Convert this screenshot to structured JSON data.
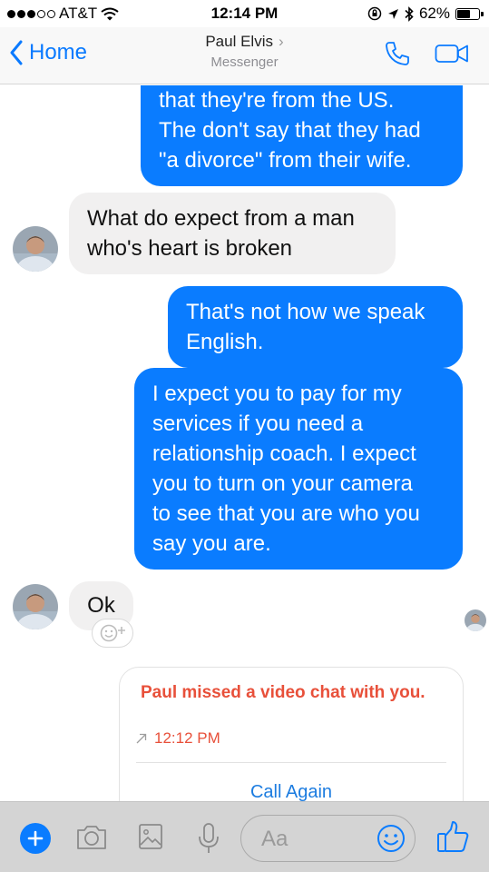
{
  "status_bar": {
    "carrier": "AT&T",
    "time": "12:14 PM",
    "battery": "62%",
    "battery_level": 0.62,
    "signal_filled": 3,
    "signal_total": 5
  },
  "header": {
    "back_label": "Home",
    "title": "Paul Elvis",
    "chevron": "›",
    "subtitle": "Messenger",
    "icons": [
      "back-chevron-icon",
      "phone-icon",
      "video-camera-icon"
    ],
    "accent_color": "#0a7aff"
  },
  "messages": [
    {
      "direction": "out",
      "text_lines": [
        "that they're from the US.",
        "The don't say that they had",
        "\"a divorce\" from their wife."
      ]
    },
    {
      "direction": "in",
      "text_lines": [
        "What do expect from a man",
        "who's heart is broken"
      ]
    },
    {
      "direction": "out",
      "text_lines": [
        "That's not how we speak",
        "English."
      ]
    },
    {
      "direction": "out",
      "text_lines": [
        "I expect you to pay for my",
        "services if you need a",
        "relationship coach.  I expect",
        "you to turn on your camera",
        "to see that you are who you",
        "say you are."
      ]
    },
    {
      "direction": "in",
      "text_lines": [
        "Ok"
      ]
    }
  ],
  "colors": {
    "outgoing_bubble": "#0a7cff",
    "incoming_bubble": "#f1f0f0",
    "missed_call_text": "#e8503a"
  },
  "missed_call": {
    "text": "Paul missed a video chat with you.",
    "time": "12:12 PM",
    "action": "Call Again"
  },
  "composer": {
    "placeholder": "Aa",
    "icons": [
      "plus-icon",
      "camera-icon",
      "gallery-icon",
      "microphone-icon",
      "emoji-icon",
      "thumbs-up-icon"
    ]
  }
}
